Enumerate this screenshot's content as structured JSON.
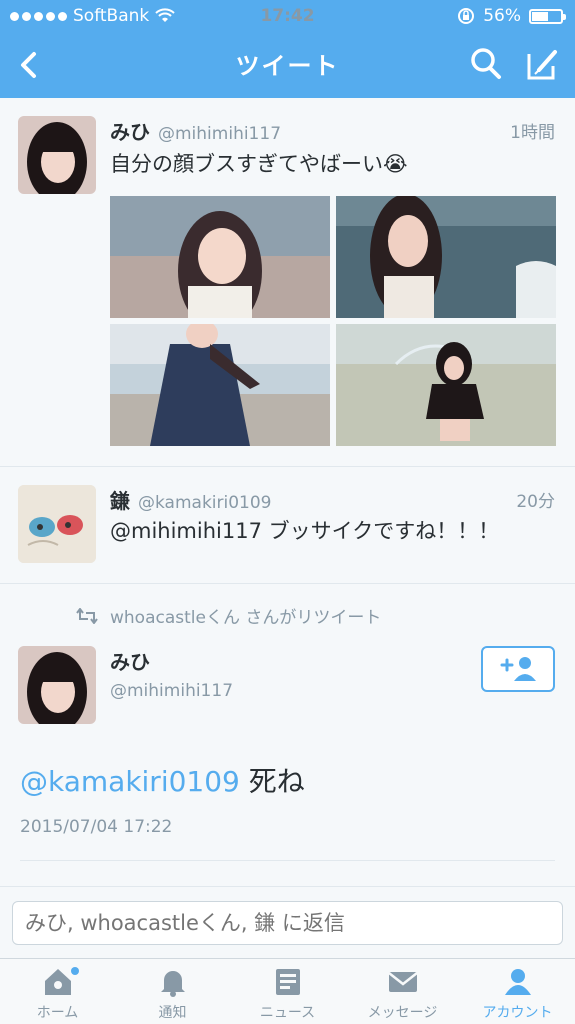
{
  "status_bar": {
    "carrier": "SoftBank",
    "time": "17:42",
    "battery": "56%"
  },
  "nav": {
    "title": "ツイート"
  },
  "tweets": [
    {
      "name": "みひ",
      "handle": "@mihimihi117",
      "time": "1時間",
      "text": "自分の顔ブスすぎてやばーい😭"
    },
    {
      "name": "鎌",
      "handle": "@kamakiri0109",
      "time": "20分",
      "text": "@mihimihi117 ブッサイクですね！！！"
    }
  ],
  "retweet": {
    "label": "whoacastleくん さんがリツイート"
  },
  "main_tweet": {
    "name": "みひ",
    "handle": "@mihimihi117",
    "mention": "@kamakiri0109",
    "text": " 死ね",
    "timestamp": "2015/07/04 17:22"
  },
  "reply": {
    "placeholder": "みひ, whoacastleくん, 鎌 に返信"
  },
  "tabs": [
    {
      "label": "ホーム",
      "icon": "home-icon"
    },
    {
      "label": "通知",
      "icon": "bell-icon"
    },
    {
      "label": "ニュース",
      "icon": "news-icon"
    },
    {
      "label": "メッセージ",
      "icon": "envelope-icon"
    },
    {
      "label": "アカウント",
      "icon": "person-icon"
    }
  ],
  "colors": {
    "accent": "#55acee",
    "background": "#f5f8fa",
    "muted": "#8899a6"
  }
}
